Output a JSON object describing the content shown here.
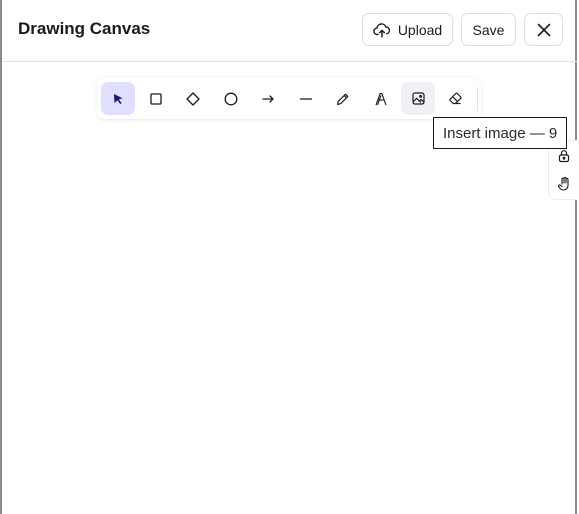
{
  "header": {
    "title": "Drawing Canvas",
    "upload_label": "Upload",
    "save_label": "Save"
  },
  "toolbar": {
    "tools": [
      {
        "name": "select",
        "icon": "cursor-arrow-icon",
        "active": true
      },
      {
        "name": "rectangle",
        "icon": "square-icon"
      },
      {
        "name": "diamond",
        "icon": "diamond-icon"
      },
      {
        "name": "ellipse",
        "icon": "circle-icon"
      },
      {
        "name": "arrow",
        "icon": "arrow-right-icon"
      },
      {
        "name": "line",
        "icon": "line-icon"
      },
      {
        "name": "draw",
        "icon": "pencil-icon"
      },
      {
        "name": "text",
        "icon": "text-icon"
      },
      {
        "name": "image",
        "icon": "image-icon",
        "hovered": true
      },
      {
        "name": "eraser",
        "icon": "eraser-icon"
      }
    ]
  },
  "tooltip": {
    "text": "Insert image — 9"
  },
  "side_panel": {
    "icons": [
      "lock-icon",
      "hand-icon"
    ]
  },
  "colors": {
    "accent_active_bg": "#e0dfff",
    "accent_icon": "#1e1b6e",
    "border": "#dcdce2"
  }
}
